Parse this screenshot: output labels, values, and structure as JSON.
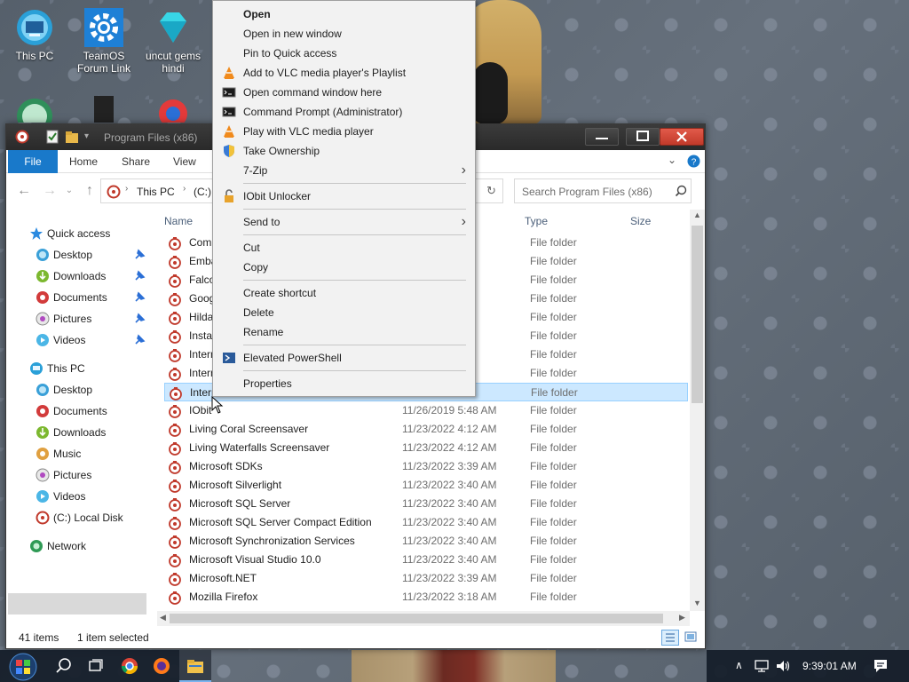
{
  "desktop": {
    "icons": [
      {
        "label": "This PC"
      },
      {
        "label": "TeamOS Forum Link"
      },
      {
        "label": "uncut gems hindi"
      }
    ]
  },
  "window": {
    "title": "Program Files (x86)",
    "ribbon_tabs": [
      "File",
      "Home",
      "Share",
      "View"
    ],
    "address": {
      "crumb": "This PC",
      "drive": "(C:)"
    },
    "search_placeholder": "Search Program Files (x86)",
    "nav": {
      "quick_access": "Quick access",
      "quick_items": [
        "Desktop",
        "Downloads",
        "Documents",
        "Pictures",
        "Videos"
      ],
      "this_pc": "This PC",
      "pc_items": [
        "Desktop",
        "Documents",
        "Downloads",
        "Music",
        "Pictures",
        "Videos",
        "(C:) Local Disk"
      ],
      "network": "Network"
    },
    "columns": {
      "name": "Name",
      "type": "Type",
      "size": "Size"
    },
    "files": [
      {
        "name": "Comm",
        "date": "",
        "type": "File folder"
      },
      {
        "name": "Embar",
        "date": "",
        "type": "File folder"
      },
      {
        "name": "Falcor",
        "date": "",
        "type": "File folder"
      },
      {
        "name": "Googl",
        "date": "",
        "type": "File folder"
      },
      {
        "name": "Hildab",
        "date": "",
        "type": "File folder"
      },
      {
        "name": "InstallS",
        "date": "",
        "type": "File folder"
      },
      {
        "name": "Interne",
        "date": "",
        "type": "File folder"
      },
      {
        "name": "Interne",
        "date": "",
        "type": "File folder"
      },
      {
        "name": "Intern",
        "date": "",
        "type": "File folder"
      },
      {
        "name": "IObit",
        "date": "11/26/2019 5:48 AM",
        "type": "File folder"
      },
      {
        "name": "Living Coral Screensaver",
        "date": "11/23/2022 4:12 AM",
        "type": "File folder"
      },
      {
        "name": "Living Waterfalls Screensaver",
        "date": "11/23/2022 4:12 AM",
        "type": "File folder"
      },
      {
        "name": "Microsoft SDKs",
        "date": "11/23/2022 3:39 AM",
        "type": "File folder"
      },
      {
        "name": "Microsoft Silverlight",
        "date": "11/23/2022 3:40 AM",
        "type": "File folder"
      },
      {
        "name": "Microsoft SQL Server",
        "date": "11/23/2022 3:40 AM",
        "type": "File folder"
      },
      {
        "name": "Microsoft SQL Server Compact Edition",
        "date": "11/23/2022 3:40 AM",
        "type": "File folder"
      },
      {
        "name": "Microsoft Synchronization Services",
        "date": "11/23/2022 3:40 AM",
        "type": "File folder"
      },
      {
        "name": "Microsoft Visual Studio 10.0",
        "date": "11/23/2022 3:40 AM",
        "type": "File folder"
      },
      {
        "name": "Microsoft.NET",
        "date": "11/23/2022 3:39 AM",
        "type": "File folder"
      },
      {
        "name": "Mozilla Firefox",
        "date": "11/23/2022 3:18 AM",
        "type": "File folder"
      }
    ],
    "status": {
      "count": "41 items",
      "selected": "1 item selected"
    }
  },
  "context_menu": {
    "items": [
      "Open",
      "Open in new window",
      "Pin to Quick access",
      "Add to VLC media player's Playlist",
      "Open command window here",
      "Command Prompt (Administrator)",
      "Play with VLC media player",
      "Take Ownership",
      "7-Zip",
      "IObit Unlocker",
      "Send to",
      "Cut",
      "Copy",
      "Create shortcut",
      "Delete",
      "Rename",
      "Elevated PowerShell",
      "Properties"
    ]
  },
  "taskbar": {
    "time": "9:39:01 AM"
  },
  "colors": {
    "accent": "#1979ca",
    "selection": "#cce8ff"
  }
}
